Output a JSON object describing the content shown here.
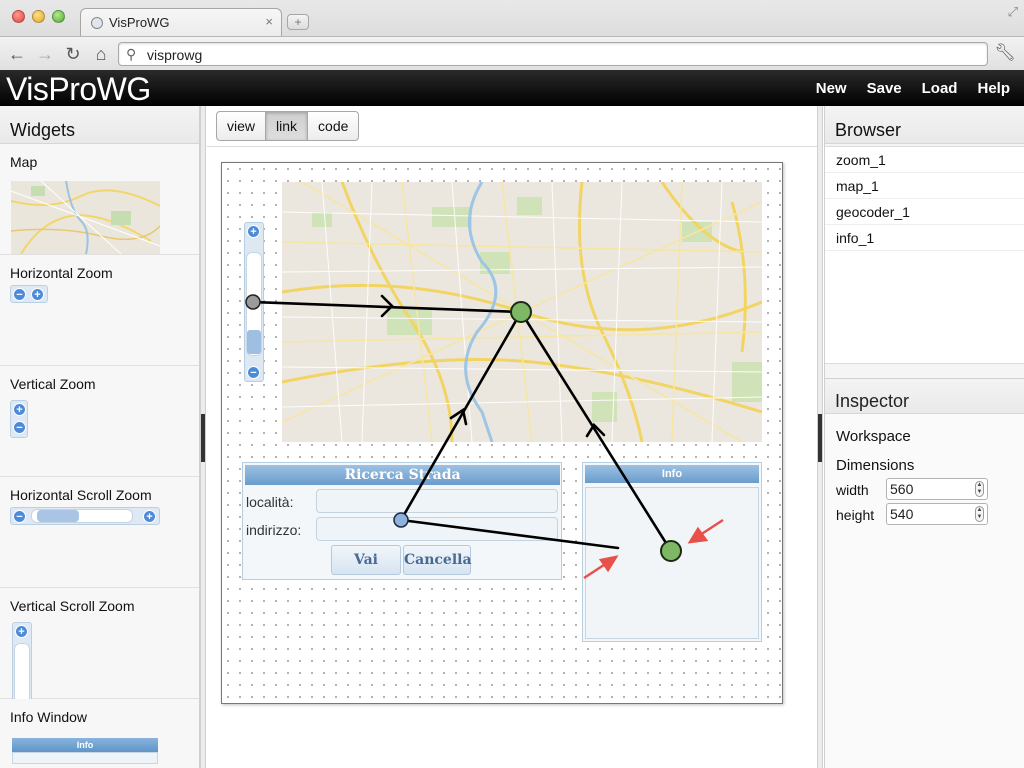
{
  "browser": {
    "tab_title": "VisProWG",
    "tab_close": "×",
    "new_tab": "+",
    "address": "visprowg",
    "nav_icons": [
      "back-icon",
      "forward-icon",
      "reload-icon",
      "home-icon",
      "search-icon",
      "wrench-icon"
    ]
  },
  "app": {
    "title": "VisProWG",
    "menu": [
      "New",
      "Save",
      "Load",
      "Help"
    ]
  },
  "widgets_panel": {
    "title": "Widgets",
    "items": [
      "Map",
      "Horizontal Zoom",
      "Vertical Zoom",
      "Horizontal Scroll Zoom",
      "Vertical Scroll Zoom",
      "Info Window"
    ],
    "info_mini_title": "Info"
  },
  "view_tabs": {
    "items": [
      "view",
      "link",
      "code"
    ],
    "active": "link"
  },
  "canvas": {
    "form": {
      "title": "Ricerca Strada",
      "label_locality": "località:",
      "label_address": "indirizzo:",
      "btn_go": "Vai",
      "btn_clear": "Cancella"
    },
    "info": {
      "title": "Info"
    },
    "zoom_plus": "+",
    "zoom_minus": "−"
  },
  "browser_panel": {
    "title": "Browser",
    "items": [
      "zoom_1",
      "map_1",
      "geocoder_1",
      "info_1"
    ]
  },
  "inspector": {
    "title": "Inspector",
    "section": "Workspace",
    "subsection": "Dimensions",
    "width_label": "width",
    "width_value": "560",
    "height_label": "height",
    "height_value": "540"
  },
  "colors": {
    "accent_blue": "#6b9ccb",
    "link_line": "#000000",
    "map_node": "#7fb865",
    "zoom_node": "#999999",
    "geocoder_node": "#8fb1e0",
    "red_arrow": "#e8504a"
  }
}
